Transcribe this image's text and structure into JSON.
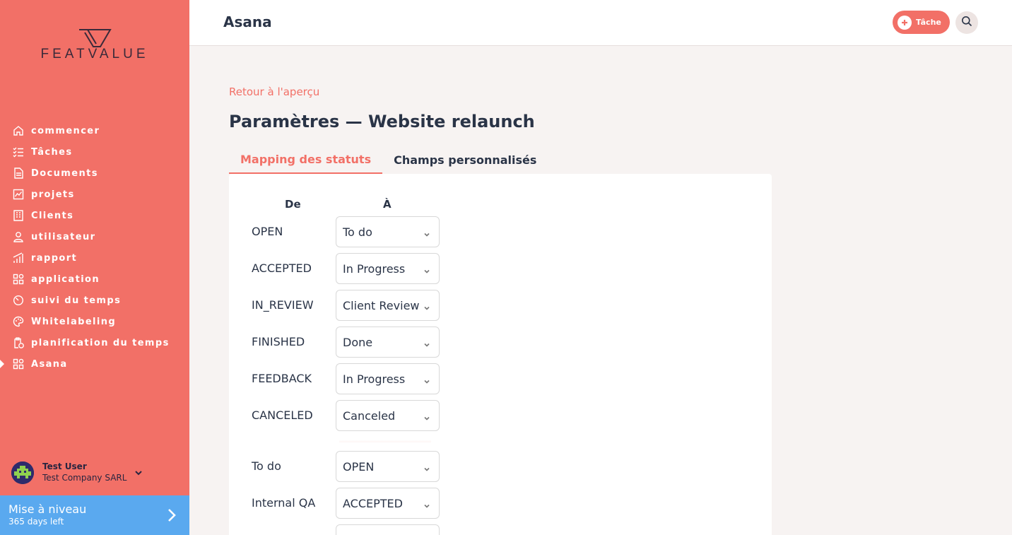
{
  "brand": {
    "logo_text": "FEATVALUE",
    "accent": "#f27067",
    "upgrade_color": "#5aa9ef"
  },
  "sidebar": {
    "items": [
      {
        "label": "commencer",
        "icon": "home-icon"
      },
      {
        "label": "Tâches",
        "icon": "checklist-icon"
      },
      {
        "label": "Documents",
        "icon": "document-icon"
      },
      {
        "label": "projets",
        "icon": "chart-icon"
      },
      {
        "label": "Clients",
        "icon": "building-icon"
      },
      {
        "label": "utilisateur",
        "icon": "user-icon"
      },
      {
        "label": "rapport",
        "icon": "bar-chart-icon"
      },
      {
        "label": "application",
        "icon": "apps-icon"
      },
      {
        "label": "suivi du temps",
        "icon": "timer-icon"
      },
      {
        "label": "Whitelabeling",
        "icon": "palette-icon"
      },
      {
        "label": "planification du temps",
        "icon": "clipboard-clock-icon"
      },
      {
        "label": "Asana",
        "icon": "apps-icon",
        "active": true
      }
    ],
    "user": {
      "name": "Test User",
      "company": "Test Company SARL"
    },
    "upgrade": {
      "title": "Mise à niveau",
      "subtitle": "365 days left"
    }
  },
  "header": {
    "title": "Asana",
    "task_button": "Tâche"
  },
  "main": {
    "back_link": "Retour à l'aperçu",
    "title": "Paramètres — Website relaunch",
    "tabs": [
      {
        "label": "Mapping des statuts",
        "active": true
      },
      {
        "label": "Champs personnalisés",
        "active": false
      }
    ],
    "columns": {
      "from": "De",
      "to": "À"
    },
    "mappings_a": [
      {
        "from": "OPEN",
        "to": "To do"
      },
      {
        "from": "ACCEPTED",
        "to": "In Progress"
      },
      {
        "from": "IN_REVIEW",
        "to": "Client Review"
      },
      {
        "from": "FINISHED",
        "to": "Done"
      },
      {
        "from": "FEEDBACK",
        "to": "In Progress"
      },
      {
        "from": "CANCELED",
        "to": "Canceled"
      }
    ],
    "mappings_b": [
      {
        "from": "To do",
        "to": "OPEN"
      },
      {
        "from": "Internal QA",
        "to": "ACCEPTED"
      },
      {
        "from": "",
        "to": ""
      }
    ]
  }
}
